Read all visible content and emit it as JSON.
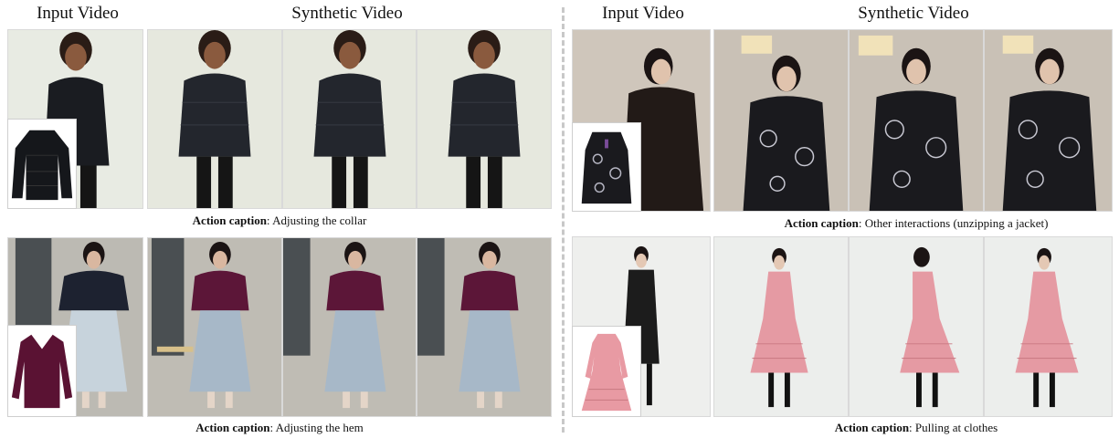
{
  "left": {
    "input_header": "Input Video",
    "synthetic_header": "Synthetic Video",
    "row1": {
      "caption_label": "Action caption",
      "caption_text": ": Adjusting the collar",
      "input_garment_color": "#1a1c21",
      "output_garment_color": "#23262d",
      "bg_color": "#e6e8de"
    },
    "row2": {
      "caption_label": "Action caption",
      "caption_text": ": Adjusting the hem",
      "input_garment_color": "#1d2230",
      "output_garment_color": "#5c1638",
      "bg_color": "#bfbcb4"
    }
  },
  "right": {
    "input_header": "Input Video",
    "synthetic_header": "Synthetic Video",
    "row1": {
      "caption_label": "Action caption",
      "caption_text": ": Other interactions (unzipping a jacket)",
      "input_garment_color": "#221a17",
      "output_garment_color": "#1a1a1e",
      "bg_color": "#c9c1b6"
    },
    "row2": {
      "caption_label": "Action caption",
      "caption_text": ": Pulling at clothes",
      "input_garment_color": "#1c1c1c",
      "output_garment_color": "#e59aa3",
      "bg_color": "#eceeec"
    }
  }
}
